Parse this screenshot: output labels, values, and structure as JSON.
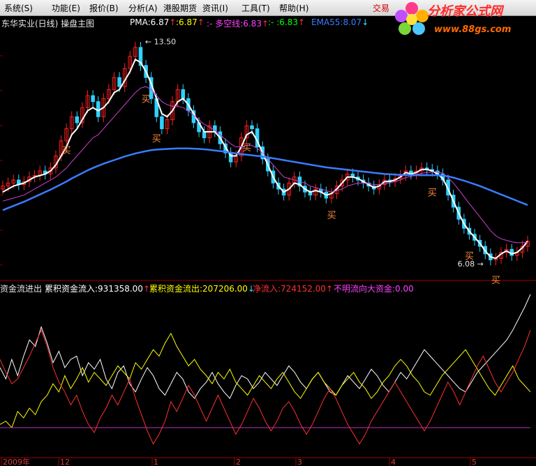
{
  "menu": [
    {
      "label": "系统(S)"
    },
    {
      "label": "功能(E)"
    },
    {
      "label": "报价(B)"
    },
    {
      "label": "分析(A)"
    },
    {
      "label": "港股期货"
    },
    {
      "label": "资讯(I)"
    },
    {
      "label": "工具(T)"
    },
    {
      "label": "帮助(H)"
    }
  ],
  "trade_label": "交易",
  "logo": {
    "text": "分析家公式网",
    "url": "www.88gs.com",
    "colors": [
      "#ff2a2a",
      "#ff6a00",
      "#ffcc00"
    ]
  },
  "main_panel": {
    "title": "东华实业(日线) 操盘主图",
    "legend": [
      {
        "text": "PMA:6.87",
        "arrow": "↑",
        "color": "#ffffff"
      },
      {
        "text": ":6.87",
        "arrow": "↑",
        "color": "#ffff00"
      },
      {
        "text": ":- 多空线:6.83",
        "arrow": "↑",
        "color": "#ff40ff"
      },
      {
        "text": ":- :6.83",
        "arrow": "↑",
        "color": "#00ff00"
      },
      {
        "text": "EMA55:8.07",
        "arrow": "↓",
        "color": "#3a7cff"
      }
    ],
    "annotations": [
      "13.50",
      "6.08"
    ]
  },
  "sub_panel": {
    "legend": [
      {
        "text": "资金流进出",
        "arrow": "",
        "color": "#e6e6e6"
      },
      {
        "text": "累积资金流入:931358.00",
        "arrow": "↑",
        "color": "#ffffff"
      },
      {
        "text": "累积资金流出:207206.00",
        "arrow": "↓",
        "color": "#ffff00"
      },
      {
        "text": "净流入:724152.00",
        "arrow": "↑",
        "color": "#ff3030"
      },
      {
        "text": "不明流向大资金:0.00",
        "arrow": "",
        "color": "#ff40ff"
      }
    ]
  },
  "x_axis": {
    "labels": [
      "2009年",
      "12",
      "1",
      "2",
      "3",
      "4",
      "5"
    ]
  },
  "chart_data": [
    {
      "type": "candlestick",
      "title": "东华实业(日线) 操盘主图",
      "ylim": [
        5.8,
        13.9
      ],
      "high_annotation": 13.5,
      "low_annotation": 6.08,
      "close": [
        8.7,
        8.8,
        8.9,
        8.75,
        8.85,
        9.0,
        9.05,
        9.2,
        9.1,
        9.3,
        9.7,
        10.2,
        10.6,
        11.0,
        10.8,
        11.3,
        11.7,
        11.5,
        11.0,
        11.6,
        11.9,
        12.3,
        12.0,
        12.6,
        13.0,
        13.3,
        12.7,
        12.3,
        11.6,
        11.0,
        10.6,
        10.9,
        11.5,
        11.9,
        11.6,
        11.2,
        10.8,
        10.5,
        10.3,
        10.7,
        10.5,
        10.1,
        9.8,
        9.5,
        9.7,
        10.3,
        10.7,
        10.6,
        10.0,
        9.6,
        9.2,
        8.8,
        8.6,
        8.4,
        8.8,
        9.0,
        8.7,
        8.5,
        8.4,
        8.6,
        8.5,
        8.3,
        8.45,
        8.7,
        8.9,
        9.1,
        9.0,
        8.9,
        8.8,
        8.7,
        8.6,
        8.75,
        8.9,
        8.85,
        8.95,
        9.05,
        9.2,
        9.1,
        9.2,
        9.3,
        9.25,
        9.2,
        9.1,
        8.9,
        8.4,
        8.0,
        7.6,
        7.3,
        7.1,
        6.9,
        6.7,
        6.45,
        6.25,
        6.3,
        6.5,
        6.6,
        6.4,
        6.5,
        6.7,
        6.87
      ],
      "series": [
        {
          "name": "PMA",
          "color": "#ffffff",
          "values": [
            8.5,
            8.6,
            8.7,
            8.75,
            8.8,
            8.9,
            9.0,
            9.05,
            9.1,
            9.2,
            9.4,
            9.7,
            10.0,
            10.4,
            10.6,
            10.9,
            11.2,
            11.3,
            11.2,
            11.3,
            11.5,
            11.8,
            11.9,
            12.2,
            12.5,
            12.9,
            12.8,
            12.5,
            12.1,
            11.6,
            11.1,
            11.0,
            11.2,
            11.5,
            11.6,
            11.4,
            11.1,
            10.8,
            10.5,
            10.5,
            10.5,
            10.3,
            10.0,
            9.7,
            9.7,
            10.0,
            10.4,
            10.5,
            10.2,
            9.8,
            9.4,
            9.0,
            8.7,
            8.5,
            8.6,
            8.8,
            8.75,
            8.6,
            8.5,
            8.55,
            8.5,
            8.4,
            8.45,
            8.6,
            8.8,
            9.0,
            9.0,
            8.95,
            8.85,
            8.75,
            8.65,
            8.7,
            8.85,
            8.85,
            8.9,
            9.0,
            9.15,
            9.1,
            9.15,
            9.25,
            9.25,
            9.2,
            9.1,
            8.95,
            8.6,
            8.2,
            7.8,
            7.45,
            7.2,
            7.0,
            6.8,
            6.55,
            6.35,
            6.3,
            6.45,
            6.55,
            6.45,
            6.5,
            6.65,
            6.87
          ]
        },
        {
          "name": "多空线",
          "color": "#d040d0",
          "values": [
            8.2,
            8.25,
            8.3,
            8.35,
            8.4,
            8.5,
            8.6,
            8.7,
            8.8,
            8.9,
            9.0,
            9.15,
            9.3,
            9.5,
            9.7,
            9.9,
            10.1,
            10.3,
            10.4,
            10.6,
            10.8,
            11.0,
            11.2,
            11.4,
            11.6,
            11.8,
            11.95,
            12.0,
            11.9,
            11.7,
            11.5,
            11.4,
            11.35,
            11.35,
            11.3,
            11.2,
            11.05,
            10.9,
            10.75,
            10.65,
            10.55,
            10.4,
            10.25,
            10.1,
            10.0,
            10.0,
            10.05,
            10.05,
            9.95,
            9.8,
            9.6,
            9.4,
            9.2,
            9.0,
            8.95,
            8.9,
            8.85,
            8.8,
            8.7,
            8.65,
            8.6,
            8.55,
            8.5,
            8.55,
            8.6,
            8.7,
            8.75,
            8.8,
            8.8,
            8.78,
            8.75,
            8.75,
            8.78,
            8.8,
            8.85,
            8.9,
            8.98,
            9.02,
            9.07,
            9.12,
            9.15,
            9.17,
            9.17,
            9.12,
            8.98,
            8.8,
            8.58,
            8.35,
            8.12,
            7.9,
            7.68,
            7.45,
            7.22,
            7.05,
            6.95,
            6.9,
            6.85,
            6.82,
            6.82,
            6.83
          ]
        },
        {
          "name": "EMA55",
          "color": "#3a7cff",
          "values": [
            7.9,
            7.97,
            8.04,
            8.11,
            8.18,
            8.26,
            8.34,
            8.42,
            8.5,
            8.58,
            8.67,
            8.76,
            8.85,
            8.95,
            9.04,
            9.13,
            9.22,
            9.3,
            9.37,
            9.44,
            9.5,
            9.56,
            9.62,
            9.68,
            9.73,
            9.78,
            9.82,
            9.86,
            9.89,
            9.91,
            9.92,
            9.93,
            9.94,
            9.95,
            9.95,
            9.95,
            9.94,
            9.93,
            9.92,
            9.9,
            9.88,
            9.86,
            9.84,
            9.81,
            9.78,
            9.76,
            9.74,
            9.72,
            9.7,
            9.68,
            9.65,
            9.62,
            9.59,
            9.56,
            9.53,
            9.5,
            9.47,
            9.44,
            9.41,
            9.38,
            9.35,
            9.32,
            9.3,
            9.28,
            9.26,
            9.24,
            9.22,
            9.2,
            9.18,
            9.16,
            9.14,
            9.12,
            9.1,
            9.09,
            9.08,
            9.07,
            9.07,
            9.06,
            9.06,
            9.06,
            9.06,
            9.06,
            9.06,
            9.05,
            9.02,
            8.98,
            8.93,
            8.88,
            8.82,
            8.76,
            8.7,
            8.63,
            8.56,
            8.49,
            8.42,
            8.35,
            8.28,
            8.21,
            8.14,
            8.07
          ]
        }
      ],
      "buy_signals": [
        12,
        27,
        29,
        46,
        62,
        81,
        88,
        93
      ]
    },
    {
      "type": "line",
      "title": "资金流进出",
      "ylim": [
        0,
        100
      ],
      "series": [
        {
          "name": "累积资金流入",
          "color": "#ffffff",
          "values": [
            55,
            48,
            60,
            50,
            62,
            72,
            68,
            80,
            70,
            58,
            65,
            55,
            60,
            62,
            50,
            58,
            54,
            60,
            48,
            42,
            52,
            56,
            45,
            40,
            48,
            55,
            50,
            42,
            38,
            45,
            52,
            48,
            40,
            36,
            42,
            46,
            52,
            45,
            40,
            36,
            44,
            50,
            48,
            42,
            46,
            52,
            48,
            44,
            50,
            56,
            52,
            46,
            42,
            48,
            52,
            46,
            40,
            38,
            44,
            50,
            46,
            42,
            48,
            54,
            50,
            44,
            40,
            46,
            52,
            48,
            54,
            60,
            66,
            62,
            58,
            54,
            50,
            46,
            42,
            40,
            46,
            52,
            56,
            60,
            64,
            68,
            72,
            78,
            85,
            92,
            100
          ]
        },
        {
          "name": "累积资金流出",
          "color": "#ffff00",
          "values": [
            20,
            22,
            18,
            28,
            24,
            30,
            26,
            34,
            38,
            45,
            40,
            50,
            42,
            48,
            55,
            46,
            52,
            48,
            44,
            50,
            56,
            52,
            48,
            58,
            54,
            60,
            66,
            62,
            70,
            76,
            68,
            62,
            56,
            60,
            54,
            50,
            45,
            52,
            48,
            54,
            46,
            42,
            38,
            44,
            50,
            46,
            42,
            48,
            52,
            46,
            40,
            36,
            42,
            48,
            52,
            46,
            42,
            38,
            44,
            48,
            52,
            46,
            42,
            36,
            40,
            46,
            50,
            56,
            60,
            56,
            50,
            46,
            40,
            38,
            44,
            50,
            54,
            58,
            62,
            66,
            60,
            54,
            48,
            42,
            38,
            44,
            50,
            56,
            48,
            44,
            40
          ]
        },
        {
          "name": "净流入",
          "color": "#ff3030",
          "values": [
            60,
            52,
            45,
            48,
            55,
            62,
            70,
            78,
            68,
            55,
            46,
            40,
            32,
            38,
            28,
            20,
            15,
            24,
            30,
            38,
            32,
            40,
            48,
            36,
            26,
            16,
            8,
            14,
            22,
            34,
            28,
            36,
            44,
            38,
            30,
            22,
            30,
            38,
            30,
            22,
            14,
            20,
            28,
            36,
            30,
            22,
            16,
            22,
            30,
            34,
            28,
            20,
            14,
            20,
            28,
            36,
            42,
            36,
            28,
            20,
            14,
            8,
            14,
            22,
            28,
            34,
            40,
            46,
            40,
            34,
            28,
            22,
            16,
            22,
            30,
            38,
            46,
            40,
            32,
            40,
            48,
            56,
            62,
            54,
            46,
            40,
            46,
            52,
            60,
            68,
            78
          ]
        },
        {
          "name": "不明流向大资金",
          "color": "#c030c0",
          "values": [
            0,
            0
          ]
        }
      ]
    }
  ]
}
